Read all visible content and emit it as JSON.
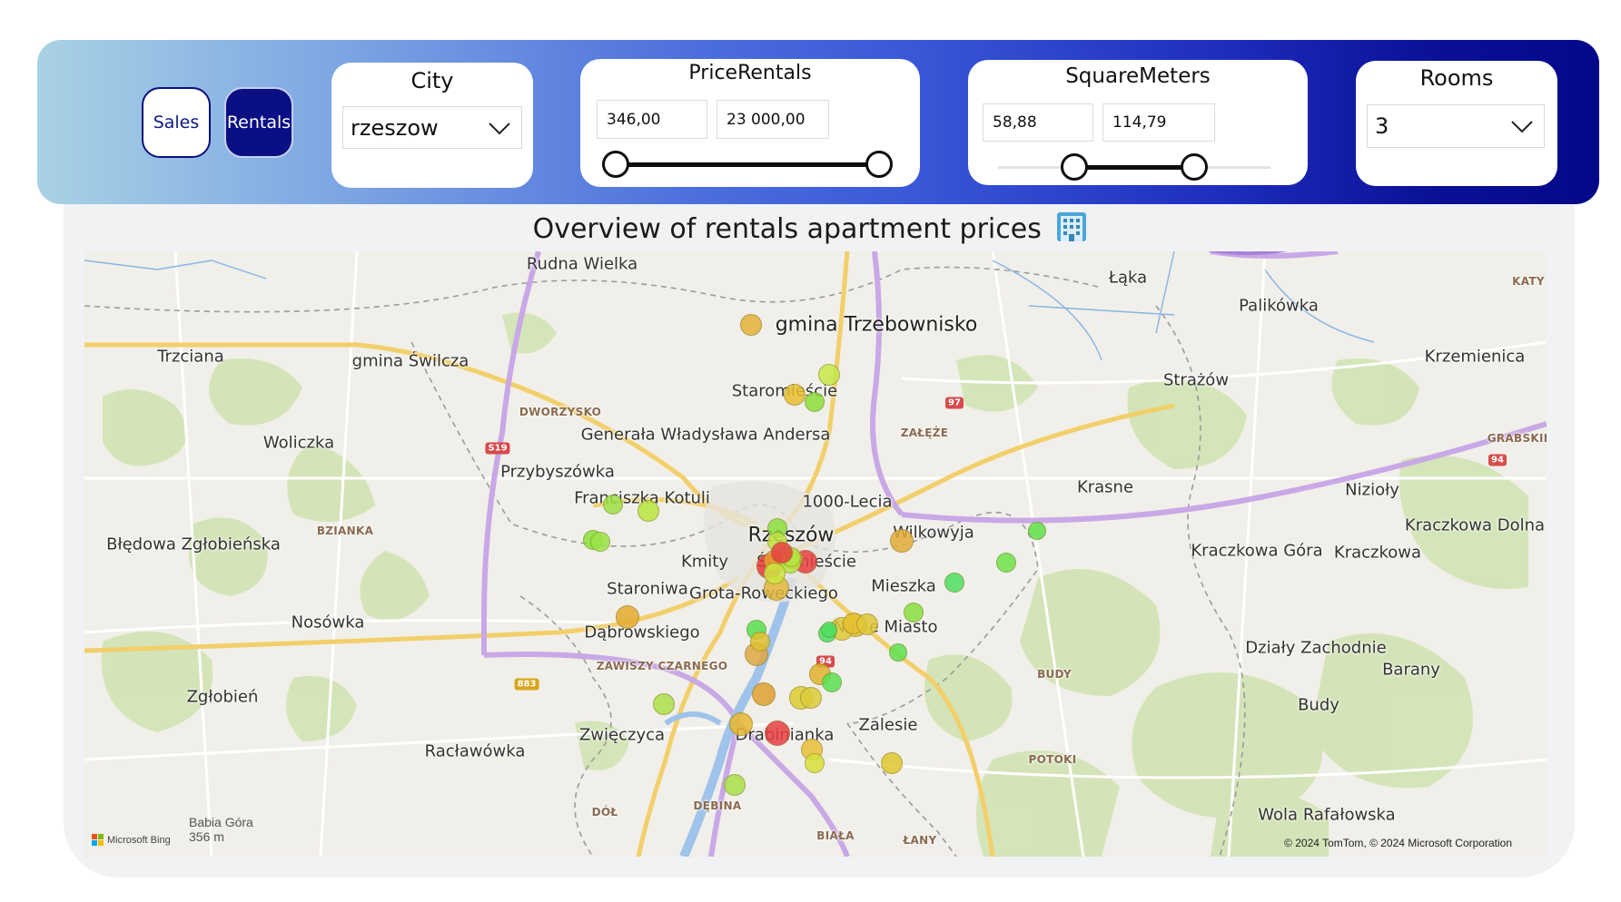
{
  "toggles": {
    "sales_label": "Sales",
    "rentals_label": "Rentals",
    "active": "Rentals"
  },
  "filters": {
    "city": {
      "title": "City",
      "value": "rzeszow"
    },
    "price": {
      "title": "PriceRentals",
      "min": "346,00",
      "max": "23 000,00",
      "range_fraction": [
        0.0,
        1.0
      ]
    },
    "area": {
      "title": "SquareMeters",
      "min": "58,88",
      "max": "114,79",
      "range_fraction": [
        0.28,
        0.72
      ]
    },
    "rooms": {
      "title": "Rooms",
      "value": "3"
    }
  },
  "map": {
    "title": "Overview of rentals apartment prices",
    "title_icon": "office-building-icon",
    "attribution": "© 2024 TomTom, © 2024 Microsoft Corporation",
    "provider": "Microsoft Bing",
    "peak": {
      "name": "Babia Góra",
      "elevation": "356 m"
    },
    "places": [
      "Rudna Wielka",
      "gmina Trzebownisko",
      "Łąka",
      "Palikówka",
      "KATY",
      "Trzciana",
      "gmina Świlcza",
      "Staromieście",
      "Krzemienica",
      "Strażów",
      "DWORZYSKO",
      "Generała Władysława Andersa",
      "ZAŁĘŻE",
      "Woliczka",
      "Przybyszówka",
      "GRABSKIE",
      "Franciszka Kotuli",
      "1000-Lecia",
      "Krasne",
      "Nizioły",
      "Błędowa Zgłobieńska",
      "BZIANKA",
      "Rzeszów",
      "Wilkowyja",
      "Kraczkowa Dolna",
      "Kmity",
      "Śródmieście",
      "Kraczkowa Góra",
      "Kraczkowa",
      "Staroniwa",
      "Grota-Roweckiego",
      "Mieszka",
      "Nosówka",
      "Dąbrowskiego",
      "Nowe Miasto",
      "Działy Zachodnie",
      "ZAWISZY CZARNEGO",
      "Barany",
      "BUDY",
      "Zgłobień",
      "Budy",
      "Zwięczyca",
      "Drabinianka",
      "Zalesie",
      "Racławówka",
      "POTOKI",
      "DĘBINA",
      "DÓŁ",
      "BIAŁA",
      "ŁANY",
      "Wola Rafałowska"
    ],
    "road_shields": [
      "S19",
      "97",
      "94",
      "94",
      "883"
    ],
    "markers": [
      {
        "color": "#e4b23a",
        "level": "mid-high"
      },
      {
        "color": "#c6e84a",
        "level": "low"
      },
      {
        "color": "#e8c030",
        "level": "mid"
      },
      {
        "color": "#8ce03a",
        "level": "low"
      },
      {
        "color": "#9ee048",
        "level": "low"
      },
      {
        "color": "#b8e63e",
        "level": "low"
      },
      {
        "color": "#8ae23a",
        "level": "low"
      },
      {
        "color": "#9be448",
        "level": "low"
      },
      {
        "color": "#8ce040",
        "level": "low"
      },
      {
        "color": "#c0e440",
        "level": "low"
      },
      {
        "color": "#e8383a",
        "level": "high"
      },
      {
        "color": "#e8a030",
        "level": "mid-high"
      },
      {
        "color": "#e84040",
        "level": "high"
      },
      {
        "color": "#e4b83a",
        "level": "mid-high"
      },
      {
        "color": "#5ee048",
        "level": "low"
      },
      {
        "color": "#6ee44a",
        "level": "low"
      },
      {
        "color": "#4ee060",
        "level": "low"
      },
      {
        "color": "#88e040",
        "level": "low"
      },
      {
        "color": "#e4ae3a",
        "level": "mid-high"
      },
      {
        "color": "#b8e440",
        "level": "low"
      },
      {
        "color": "#e2b83c",
        "level": "mid-high"
      },
      {
        "color": "#e4c030",
        "level": "mid"
      },
      {
        "color": "#e0c838",
        "level": "mid"
      },
      {
        "color": "#4ae060",
        "level": "low"
      },
      {
        "color": "#e4ac30",
        "level": "mid-high"
      },
      {
        "color": "#58e050",
        "level": "low"
      },
      {
        "color": "#e0a844",
        "level": "mid-high"
      },
      {
        "color": "#e0b230",
        "level": "mid"
      },
      {
        "color": "#dccc30",
        "level": "mid"
      },
      {
        "color": "#dccc38",
        "level": "mid"
      },
      {
        "color": "#5ae050",
        "level": "low"
      },
      {
        "color": "#e0a030",
        "level": "mid-high"
      },
      {
        "color": "#aee04a",
        "level": "low"
      },
      {
        "color": "#e84040",
        "level": "high"
      },
      {
        "color": "#e8c038",
        "level": "mid"
      },
      {
        "color": "#d8e03c",
        "level": "mid"
      },
      {
        "color": "#e0c830",
        "level": "mid"
      },
      {
        "color": "#a8e048",
        "level": "low"
      },
      {
        "color": "#e0c030",
        "level": "mid"
      },
      {
        "color": "#5ee050",
        "level": "low"
      },
      {
        "color": "#e8c030",
        "level": "mid"
      },
      {
        "color": "#e0c838",
        "level": "mid"
      },
      {
        "color": "#cde640",
        "level": "low"
      },
      {
        "color": "#4ee060",
        "level": "low"
      },
      {
        "color": "#b4e440",
        "level": "low"
      },
      {
        "color": "#e8b830",
        "level": "mid"
      },
      {
        "color": "#e84040",
        "level": "high"
      }
    ]
  }
}
